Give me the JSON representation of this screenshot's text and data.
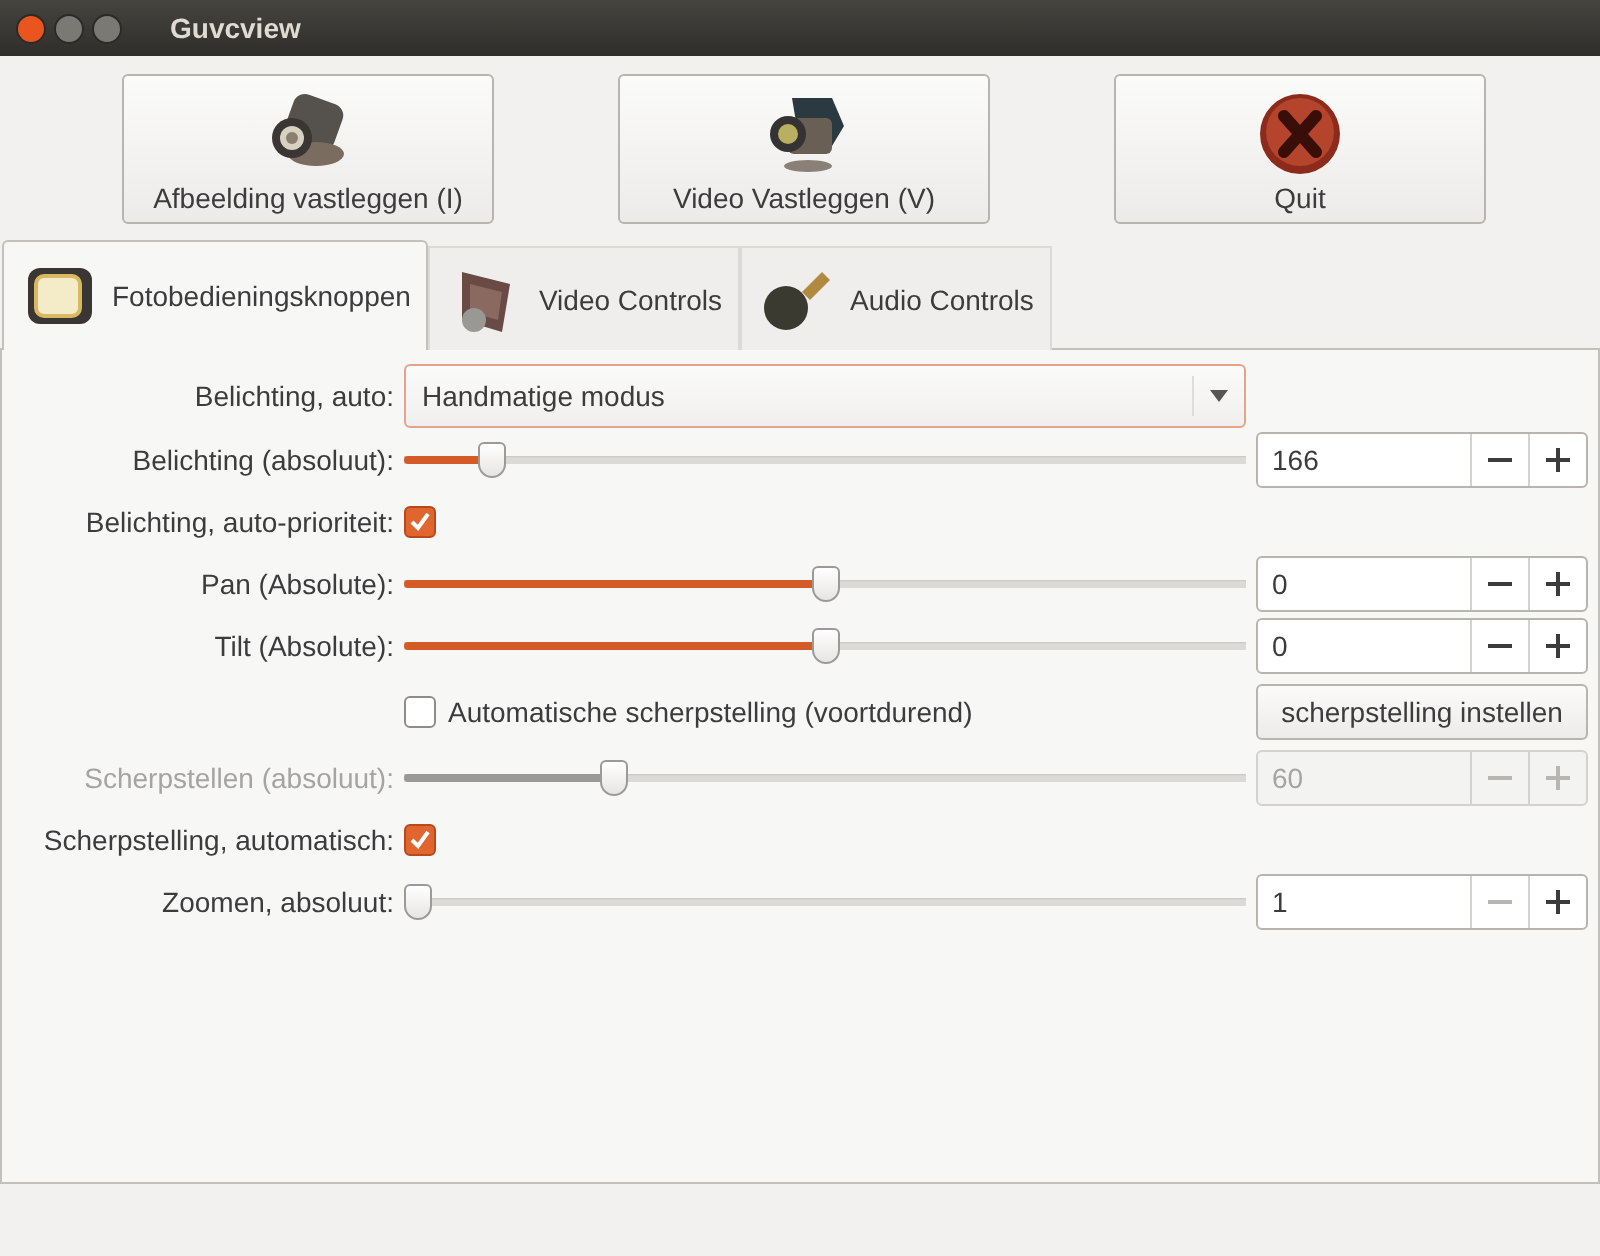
{
  "window": {
    "title": "Guvcview"
  },
  "actions": [
    {
      "kind": "photo",
      "label": "Afbeelding vastleggen (I)"
    },
    {
      "kind": "video",
      "label": "Video Vastleggen (V)"
    },
    {
      "kind": "quit",
      "label": "Quit"
    }
  ],
  "tabs": [
    {
      "kind": "photo",
      "label": "Fotobedieningsknoppen",
      "selected": true
    },
    {
      "kind": "video",
      "label": "Video Controls",
      "selected": false
    },
    {
      "kind": "audio",
      "label": "Audio Controls",
      "selected": false
    }
  ],
  "controls": [
    {
      "kind": "combo",
      "label": "Belichting, auto:",
      "value": "Handmatige modus"
    },
    {
      "kind": "slider",
      "label": "Belichting (absoluut):",
      "level": 0.09,
      "value": "166",
      "disabled": false,
      "minus_disabled": false
    },
    {
      "kind": "checkbox",
      "label": "Belichting, auto-prioriteit:",
      "checked": true
    },
    {
      "kind": "slider",
      "label": "Pan (Absolute):",
      "level": 0.5,
      "value": "0",
      "disabled": false,
      "minus_disabled": false
    },
    {
      "kind": "slider",
      "label": "Tilt (Absolute):",
      "level": 0.5,
      "value": "0",
      "disabled": false,
      "minus_disabled": false
    },
    {
      "kind": "check_button",
      "label": "Automatische scherpstelling (voortdurend)",
      "checked": false,
      "button": "scherpstelling instellen"
    },
    {
      "kind": "slider",
      "label": "Scherpstellen (absoluut):",
      "level": 0.24,
      "value": "60",
      "disabled": true,
      "minus_disabled": true
    },
    {
      "kind": "checkbox",
      "label": "Scherpstelling, automatisch:",
      "checked": true
    },
    {
      "kind": "slider",
      "label": "Zoomen, absoluut:",
      "level": 0,
      "value": "1",
      "disabled": false,
      "minus_disabled": true
    }
  ]
}
